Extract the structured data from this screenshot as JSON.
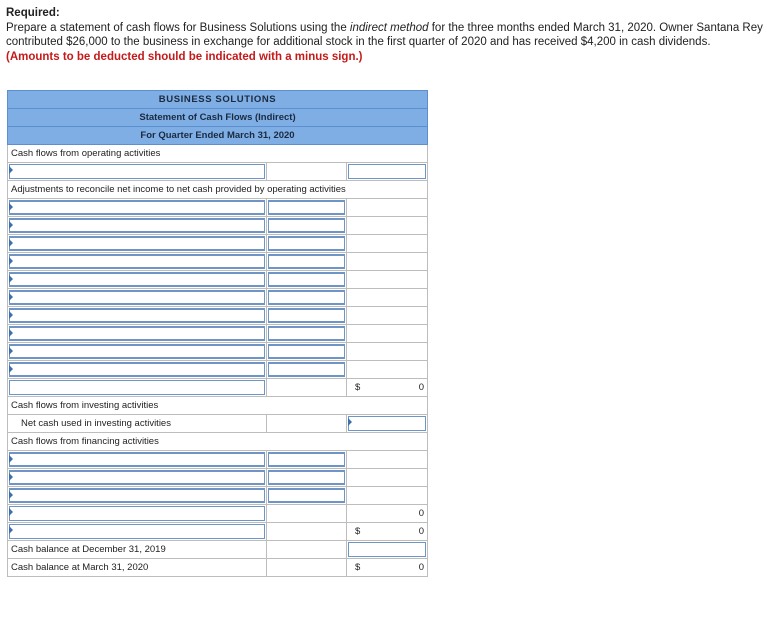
{
  "instructions": {
    "required_label": "Required:",
    "text_before_italic": "Prepare a statement of cash flows for Business Solutions using the ",
    "italic_text": "indirect method",
    "text_after_italic": " for the three months ended March 31, 2020. Owner Santana Rey contributed $26,000 to the business in exchange for additional stock in the first quarter of 2020 and has received $4,200 in cash dividends. ",
    "note": "(Amounts to be deducted should be indicated with a minus sign.)"
  },
  "statement": {
    "company": "BUSINESS SOLUTIONS",
    "title": "Statement of Cash Flows (Indirect)",
    "period": "For Quarter Ended March 31, 2020",
    "operating_label": "Cash flows from operating activities",
    "adjustments_label": "Adjustments to reconcile net income to net cash provided by operating activities",
    "operating_total": {
      "currency": "$",
      "value": "0"
    },
    "investing_label": "Cash flows from investing activities",
    "net_investing_label": "Net cash used in investing activities",
    "financing_label": "Cash flows from financing activities",
    "financing_total": {
      "value": "0"
    },
    "net_change": {
      "currency": "$",
      "value": "0"
    },
    "beginning_label": "Cash balance at December 31, 2019",
    "ending_label": "Cash balance at March 31, 2020",
    "ending_total": {
      "currency": "$",
      "value": "0"
    }
  },
  "colors": {
    "header_bg": "#7eaee4",
    "input_border": "#6e95c6",
    "note_red": "#c41a1a"
  }
}
